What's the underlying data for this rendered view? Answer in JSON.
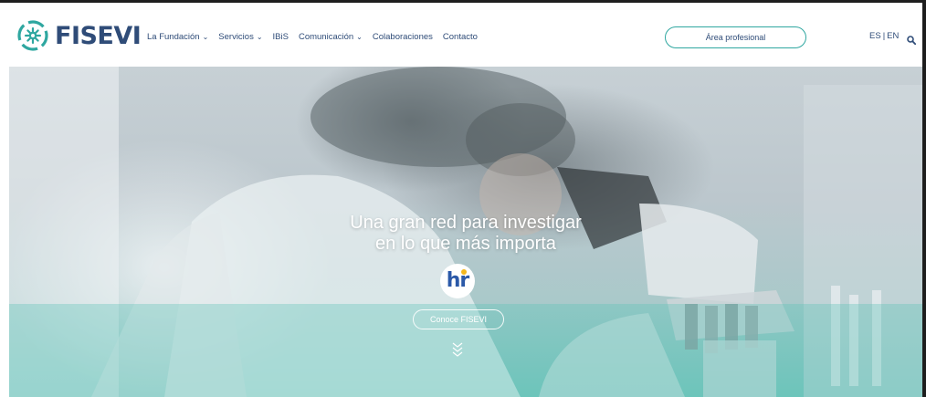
{
  "brand": {
    "logo_text": "FISEVI",
    "colors": {
      "navy": "#2f4c78",
      "teal": "#2fa7a0",
      "badge_blue": "#2b59a8",
      "badge_yellow": "#f4b81e"
    }
  },
  "nav": {
    "items": [
      {
        "label": "La Fundación",
        "has_dropdown": true
      },
      {
        "label": "Servicios",
        "has_dropdown": true
      },
      {
        "label": "IBiS",
        "has_dropdown": false
      },
      {
        "label": "Comunicación",
        "has_dropdown": true
      },
      {
        "label": "Colaboraciones",
        "has_dropdown": false
      },
      {
        "label": "Contacto",
        "has_dropdown": false
      }
    ],
    "chevron_glyph": "⌄"
  },
  "header": {
    "pro_button_label": "Área profesional",
    "lang_es": "ES",
    "lang_sep": "|",
    "lang_en": "EN",
    "search_icon": "search-icon"
  },
  "hero": {
    "title_line1": "Una gran red para investigar",
    "title_line2": "en lo que más importa",
    "badge_text": "hr",
    "cta_label": "Conoce FISEVI",
    "scroll_icon": "double-chevron-down-icon"
  }
}
